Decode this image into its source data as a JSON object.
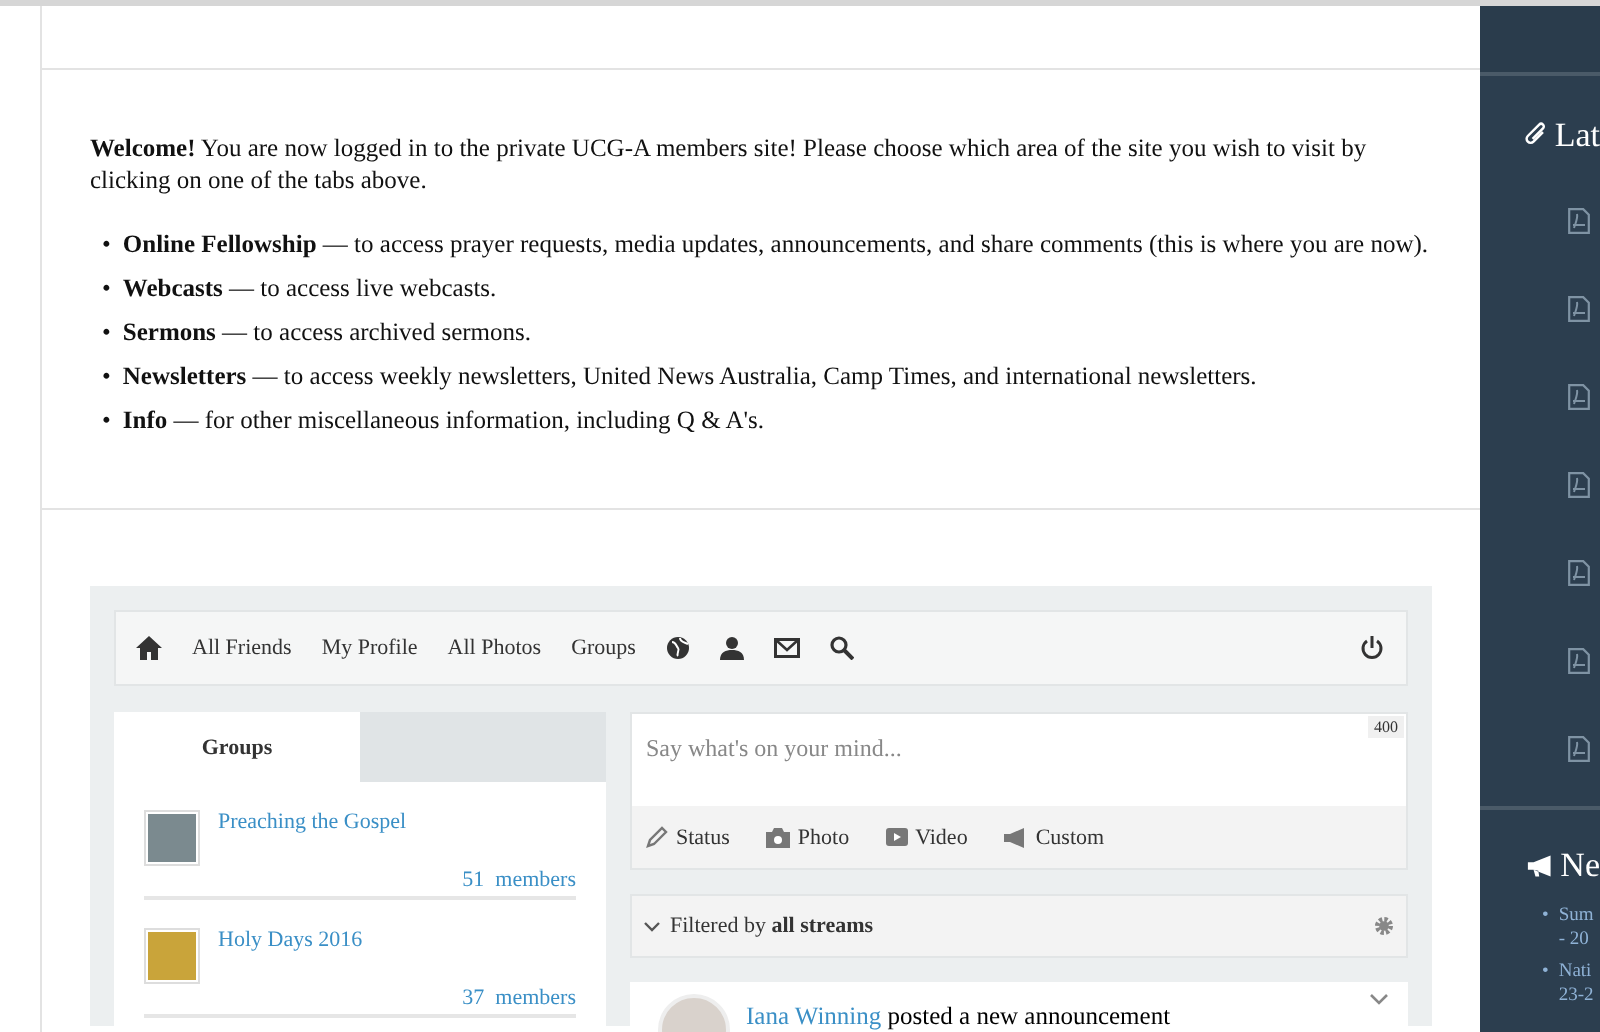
{
  "welcome": {
    "text": "**Welcome!** You are now logged in to the private UCG-A members site! Please choose which area of the site you wish to visit by clicking on one of the tabs above.",
    "items": [
      {
        "bullet": "•",
        "title": "Online Fellowship",
        "text": "— to access prayer requests, media updates, announcements, and share comments (this is where you are now)."
      },
      {
        "bullet": "•",
        "title": "Webcasts",
        "text": "— to access live webcasts."
      },
      {
        "bullet": "•",
        "title": "Sermons",
        "text": "— to access archived sermons."
      },
      {
        "bullet": "•",
        "title": "Newsletters",
        "text": "— to access weekly newsletters, United News Australia, Camp Times, and international newsletters."
      },
      {
        "bullet": "•",
        "title": "Info",
        "text": "— for other miscellaneous information, including Q & A's."
      }
    ]
  },
  "social": {
    "nav_links": [
      "All Friends",
      "My Profile",
      "All Photos",
      "Groups"
    ],
    "groups_tab": "Groups",
    "groups": [
      {
        "name": "Preaching the Gospel",
        "members": "51  members"
      },
      {
        "name": "Holy Days 2016",
        "members": "37  members"
      }
    ],
    "composer": {
      "placeholder": "Say what's on your mind...",
      "counter": "400",
      "actions": [
        {
          "kind": "status",
          "label": "Status"
        },
        {
          "kind": "photo",
          "label": "Photo"
        },
        {
          "kind": "video",
          "label": "Video"
        },
        {
          "kind": "custom",
          "label": "Custom"
        }
      ]
    },
    "filter": "Filtered by **all streams**",
    "post": {
      "author": "Iana Winning",
      "text": "posted a new announcement"
    }
  },
  "sidebar": {
    "attachments_title": "Lat",
    "attachments": [
      {
        "kind": "pdf"
      },
      {
        "kind": "pdf"
      },
      {
        "kind": "pdf"
      },
      {
        "kind": "pdf"
      },
      {
        "kind": "pdf"
      },
      {
        "kind": "pdf"
      },
      {
        "kind": "pdf"
      }
    ],
    "news_title": "Ne",
    "news": [
      {
        "bullet": "•",
        "line_1": "Sum",
        "line_2": "- 20"
      },
      {
        "bullet": "•",
        "line_1": "Nati",
        "line_2": "23-2"
      }
    ]
  }
}
